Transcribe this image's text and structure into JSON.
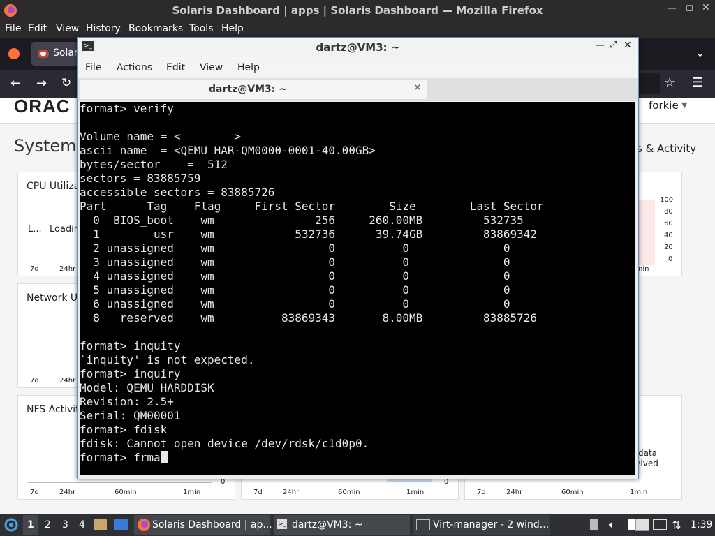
{
  "firefox": {
    "title": "Solaris Dashboard | apps | Solaris Dashboard — Mozilla Firefox",
    "menu": [
      "File",
      "Edit",
      "View",
      "History",
      "Bookmarks",
      "Tools",
      "Help"
    ],
    "tab_label": "Solar",
    "user": "forkie",
    "page_logo": "ORAC",
    "page_heading": "System",
    "right_link": "s & Activity",
    "panels": {
      "cpu": {
        "title": "CPU Utiliza",
        "left1": "L...",
        "left2": "Loadin",
        "ticks": [
          "7d",
          "24hr"
        ]
      },
      "network": {
        "title": "Network U",
        "ticks": [
          "7d",
          "24hr"
        ]
      },
      "nfs": {
        "title": "NFS Activit",
        "ticks": [
          "7d",
          "24hr",
          "60min",
          "1min"
        ],
        "zero": "0"
      },
      "middle": {
        "ticks": [
          "7d",
          "24hr",
          "60min",
          "1min"
        ],
        "zero": "0"
      },
      "right": {
        "ticks": [
          "7d",
          "24hr",
          "60min",
          "1min"
        ],
        "legend1": "data",
        "legend2": "eived"
      },
      "cpu_right": {
        "yticks": [
          "100",
          "80",
          "60",
          "40",
          "20",
          "0"
        ],
        "xtick": "nin"
      }
    }
  },
  "terminal": {
    "title": "dartz@VM3: ~",
    "menu": [
      "File",
      "Actions",
      "Edit",
      "View",
      "Help"
    ],
    "tab_label": "dartz@VM3: ~",
    "lines": [
      "format> verify",
      "",
      "Volume name = <        >",
      "ascii name  = <QEMU HAR-QM0000-0001-40.00GB>",
      "bytes/sector    =  512",
      "sectors = 83885759",
      "accessible sectors = 83885726",
      "Part      Tag    Flag     First Sector        Size        Last Sector",
      "  0  BIOS_boot    wm               256     260.00MB         532735",
      "  1        usr    wm            532736      39.74GB         83869342",
      "  2 unassigned    wm                 0          0              0",
      "  3 unassigned    wm                 0          0              0",
      "  4 unassigned    wm                 0          0              0",
      "  5 unassigned    wm                 0          0              0",
      "  6 unassigned    wm                 0          0              0",
      "  8   reserved    wm          83869343       8.00MB         83885726",
      "",
      "format> inquity",
      "`inquity' is not expected.",
      "format> inquiry",
      "Model: QEMU HARDDISK",
      "Revision: 2.5+",
      "Serial: QM00001",
      "format> fdisk",
      "fdisk: Cannot open device /dev/rdsk/c1d0p0."
    ],
    "prompt_line": "format> frma"
  },
  "taskbar": {
    "workspaces": [
      "1",
      "2",
      "3",
      "4"
    ],
    "items": [
      "Solaris Dashboard | ap...",
      "dartz@VM3: ~",
      "Virt-manager - 2 wind..."
    ],
    "clock": "1:39"
  }
}
